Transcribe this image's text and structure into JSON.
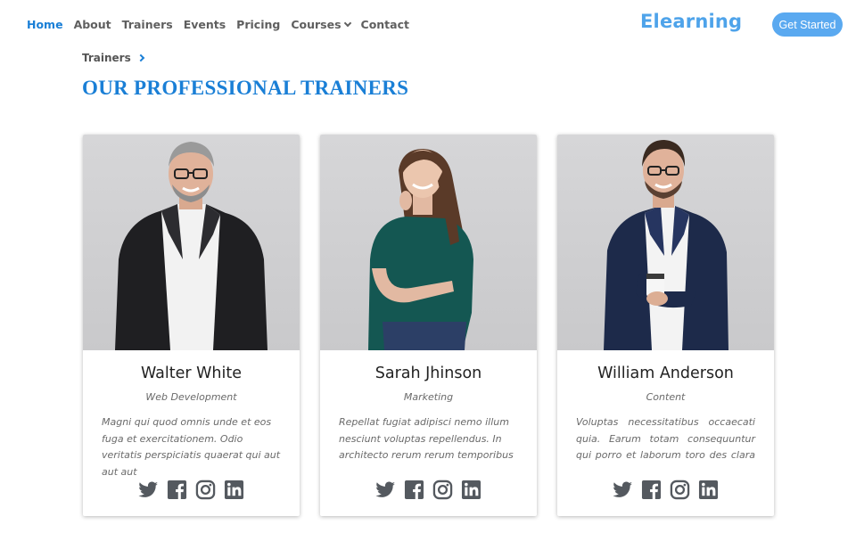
{
  "nav": {
    "items": [
      "Home",
      "About",
      "Trainers",
      "Events",
      "Pricing",
      "Courses",
      "Contact"
    ],
    "active": "Home"
  },
  "brand": {
    "logo": "Elearning",
    "cta": "Get Started"
  },
  "breadcrumb": {
    "current": "Trainers"
  },
  "page": {
    "title": "OUR PROFESSIONAL TRAINERS"
  },
  "trainers": [
    {
      "name": "Walter White",
      "role": "Web Development",
      "bio": "Magni qui quod omnis unde et eos fuga et exercitationem. Odio veritatis perspiciatis quaerat qui aut aut aut"
    },
    {
      "name": "Sarah Jhinson",
      "role": "Marketing",
      "bio": "Repellat fugiat adipisci nemo illum nesciunt voluptas repellendus. In architecto rerum rerum temporibus"
    },
    {
      "name": "William Anderson",
      "role": "Content",
      "bio": "Voluptas necessitatibus occaecati quia. Earum totam consequuntur qui porro et laborum toro des clara"
    }
  ],
  "social_icons": [
    "twitter-icon",
    "facebook-icon",
    "instagram-icon",
    "linkedin-icon"
  ],
  "colors": {
    "accent": "#1a7fd6",
    "logo": "#4ea3ea",
    "button": "#5aa9f0",
    "icon": "#54595f"
  }
}
